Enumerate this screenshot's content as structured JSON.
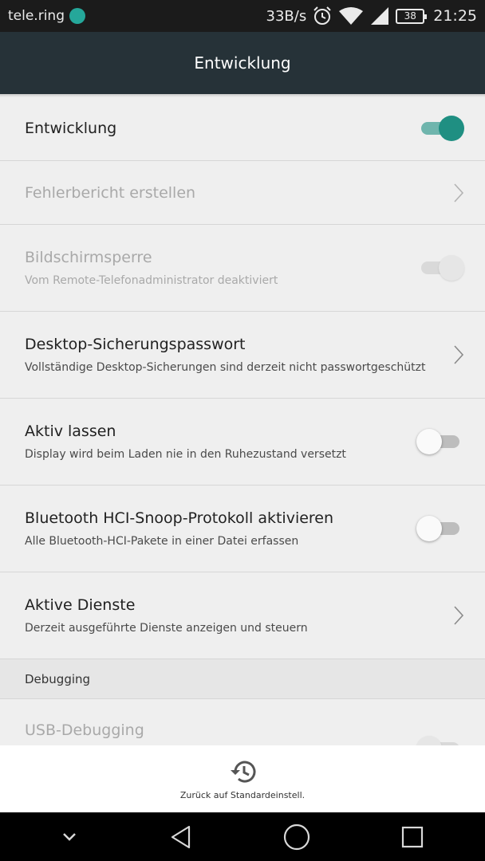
{
  "status_bar": {
    "carrier": "tele.ring",
    "speed": "33B/s",
    "battery": "38",
    "time": "21:25"
  },
  "app_bar": {
    "title": "Entwicklung"
  },
  "rows": [
    {
      "title": "Entwicklung",
      "control": "switch",
      "state": "on",
      "enabled": true
    },
    {
      "title": "Fehlerbericht erstellen",
      "control": "chevron",
      "enabled": false
    },
    {
      "title": "Bildschirmsperre",
      "subtitle": "Vom Remote-Telefonadministrator deaktiviert",
      "control": "switch",
      "state": "on",
      "enabled": false
    },
    {
      "title": "Desktop-Sicherungspasswort",
      "subtitle": "Vollständige Desktop-Sicherungen sind derzeit nicht passwortgeschützt",
      "control": "chevron",
      "enabled": true
    },
    {
      "title": "Aktiv lassen",
      "subtitle": "Display wird beim Laden nie in den Ruhezustand versetzt",
      "control": "switch",
      "state": "off",
      "enabled": true
    },
    {
      "title": "Bluetooth HCI-Snoop-Protokoll aktivieren",
      "subtitle": "Alle Bluetooth-HCI-Pakete in einer Datei erfassen",
      "control": "switch",
      "state": "off",
      "enabled": true
    },
    {
      "title": "Aktive Dienste",
      "subtitle": "Derzeit ausgeführte Dienste anzeigen und steuern",
      "control": "chevron",
      "enabled": true
    }
  ],
  "section": {
    "label": "Debugging"
  },
  "usb_row": {
    "title": "USB-Debugging",
    "control": "switch",
    "state": "off",
    "enabled": false
  },
  "bottom_action": {
    "label": "Zurück auf Standardeinstell.",
    "icon": "restore-history-icon"
  },
  "nav": {
    "icons": [
      "chevron-down-icon",
      "back-icon",
      "home-icon",
      "recents-icon"
    ]
  },
  "colors": {
    "accent": "#1f8f82",
    "app_bar": "#263238",
    "status_bar": "#1b1b1b"
  }
}
